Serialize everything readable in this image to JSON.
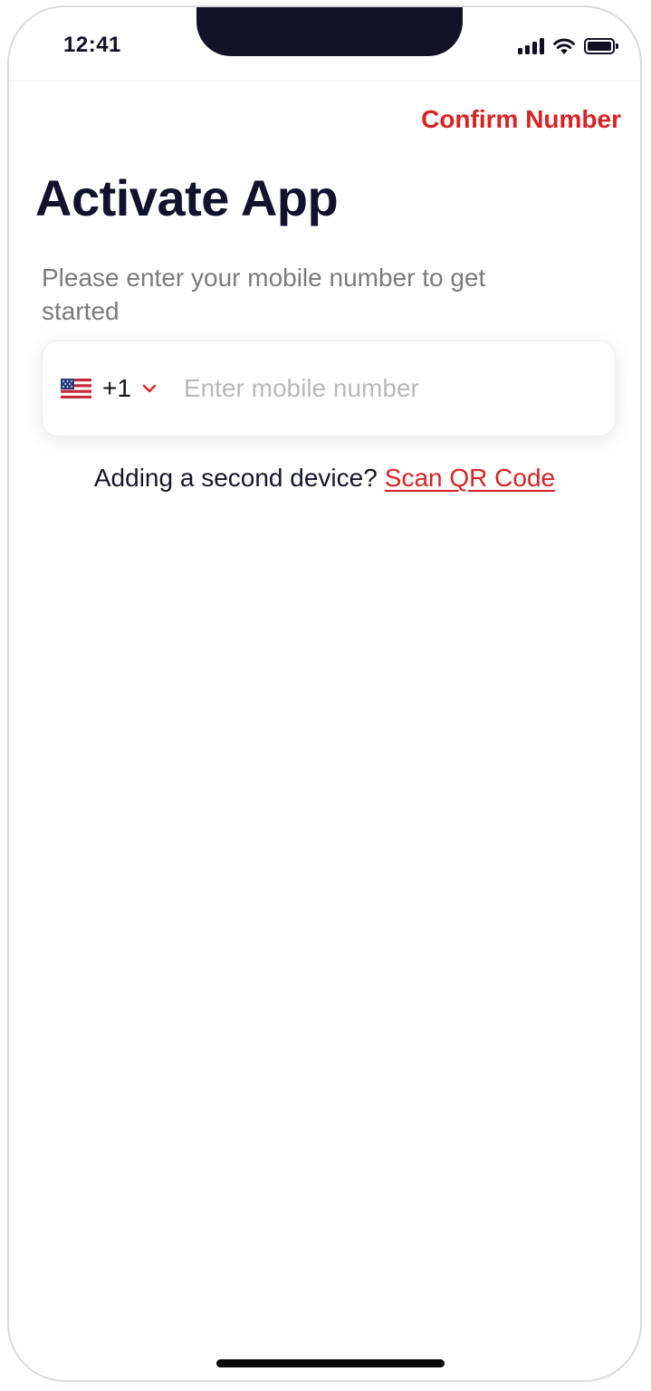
{
  "status_bar": {
    "time": "12:41"
  },
  "header": {
    "confirm_label": "Confirm Number"
  },
  "main": {
    "title": "Activate App",
    "subtitle": "Please enter your mobile number to get started",
    "phone_field": {
      "country_flag": "us-flag-icon",
      "dial_code": "+1",
      "value": "",
      "placeholder": "Enter mobile number"
    },
    "second_device": {
      "prompt": "Adding a second device?",
      "link_label": "Scan QR Code"
    }
  },
  "colors": {
    "accent": "#d92323",
    "title": "#10122e",
    "subtitle": "#7b7b7b",
    "placeholder": "#b9b9bc"
  }
}
